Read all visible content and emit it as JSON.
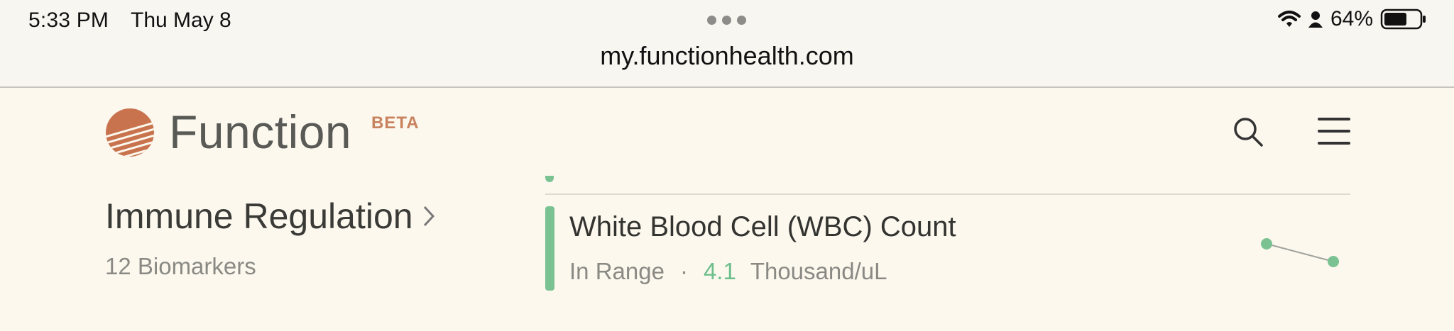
{
  "status_bar": {
    "time": "5:33 PM",
    "date": "Thu May 8",
    "battery_percent": "64%",
    "battery_level": 0.64,
    "url": "my.functionhealth.com"
  },
  "header": {
    "brand": "Function",
    "badge": "BETA",
    "icons": {
      "search": "search-icon",
      "menu": "hamburger-menu-icon"
    }
  },
  "section": {
    "title": "Immune Regulation",
    "subtitle": "12 Biomarkers"
  },
  "biomarker": {
    "name": "White Blood Cell (WBC) Count",
    "status": "In Range",
    "separator": "·",
    "value": "4.1",
    "unit": "Thousand/uL",
    "status_color": "#7bc293",
    "trend": "decreasing"
  },
  "colors": {
    "accent_green": "#7bc293",
    "brand_orange": "#c8825e",
    "background": "#fcf8ee"
  }
}
